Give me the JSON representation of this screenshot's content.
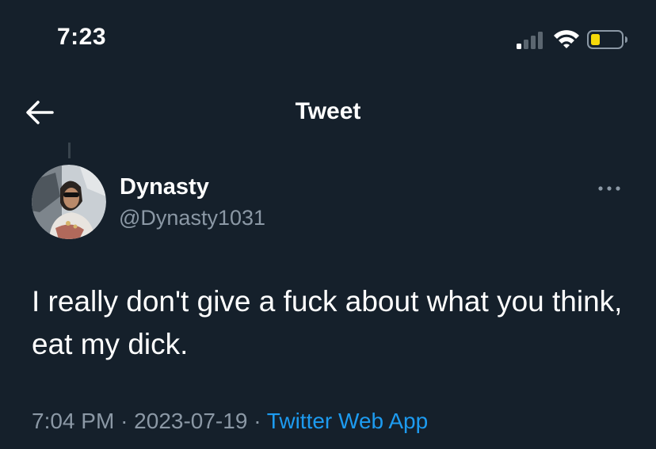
{
  "status_bar": {
    "time": "7:23",
    "icons": [
      "cellular-signal-icon",
      "wifi-icon",
      "battery-icon"
    ],
    "battery_color": "#f5d90a"
  },
  "header": {
    "title": "Tweet",
    "back_icon": "arrow-left-icon"
  },
  "tweet": {
    "author_name": "Dynasty",
    "author_handle": "@Dynasty1031",
    "text": "I really don't give a fuck about what you think, eat my dick.",
    "time": "7:04 PM",
    "separator": "·",
    "date": "2023-07-19",
    "source": "Twitter Web App"
  },
  "colors": {
    "background": "#15202b",
    "text": "#ffffff",
    "secondary_text": "#8b98a5",
    "link": "#1d9bf0"
  }
}
